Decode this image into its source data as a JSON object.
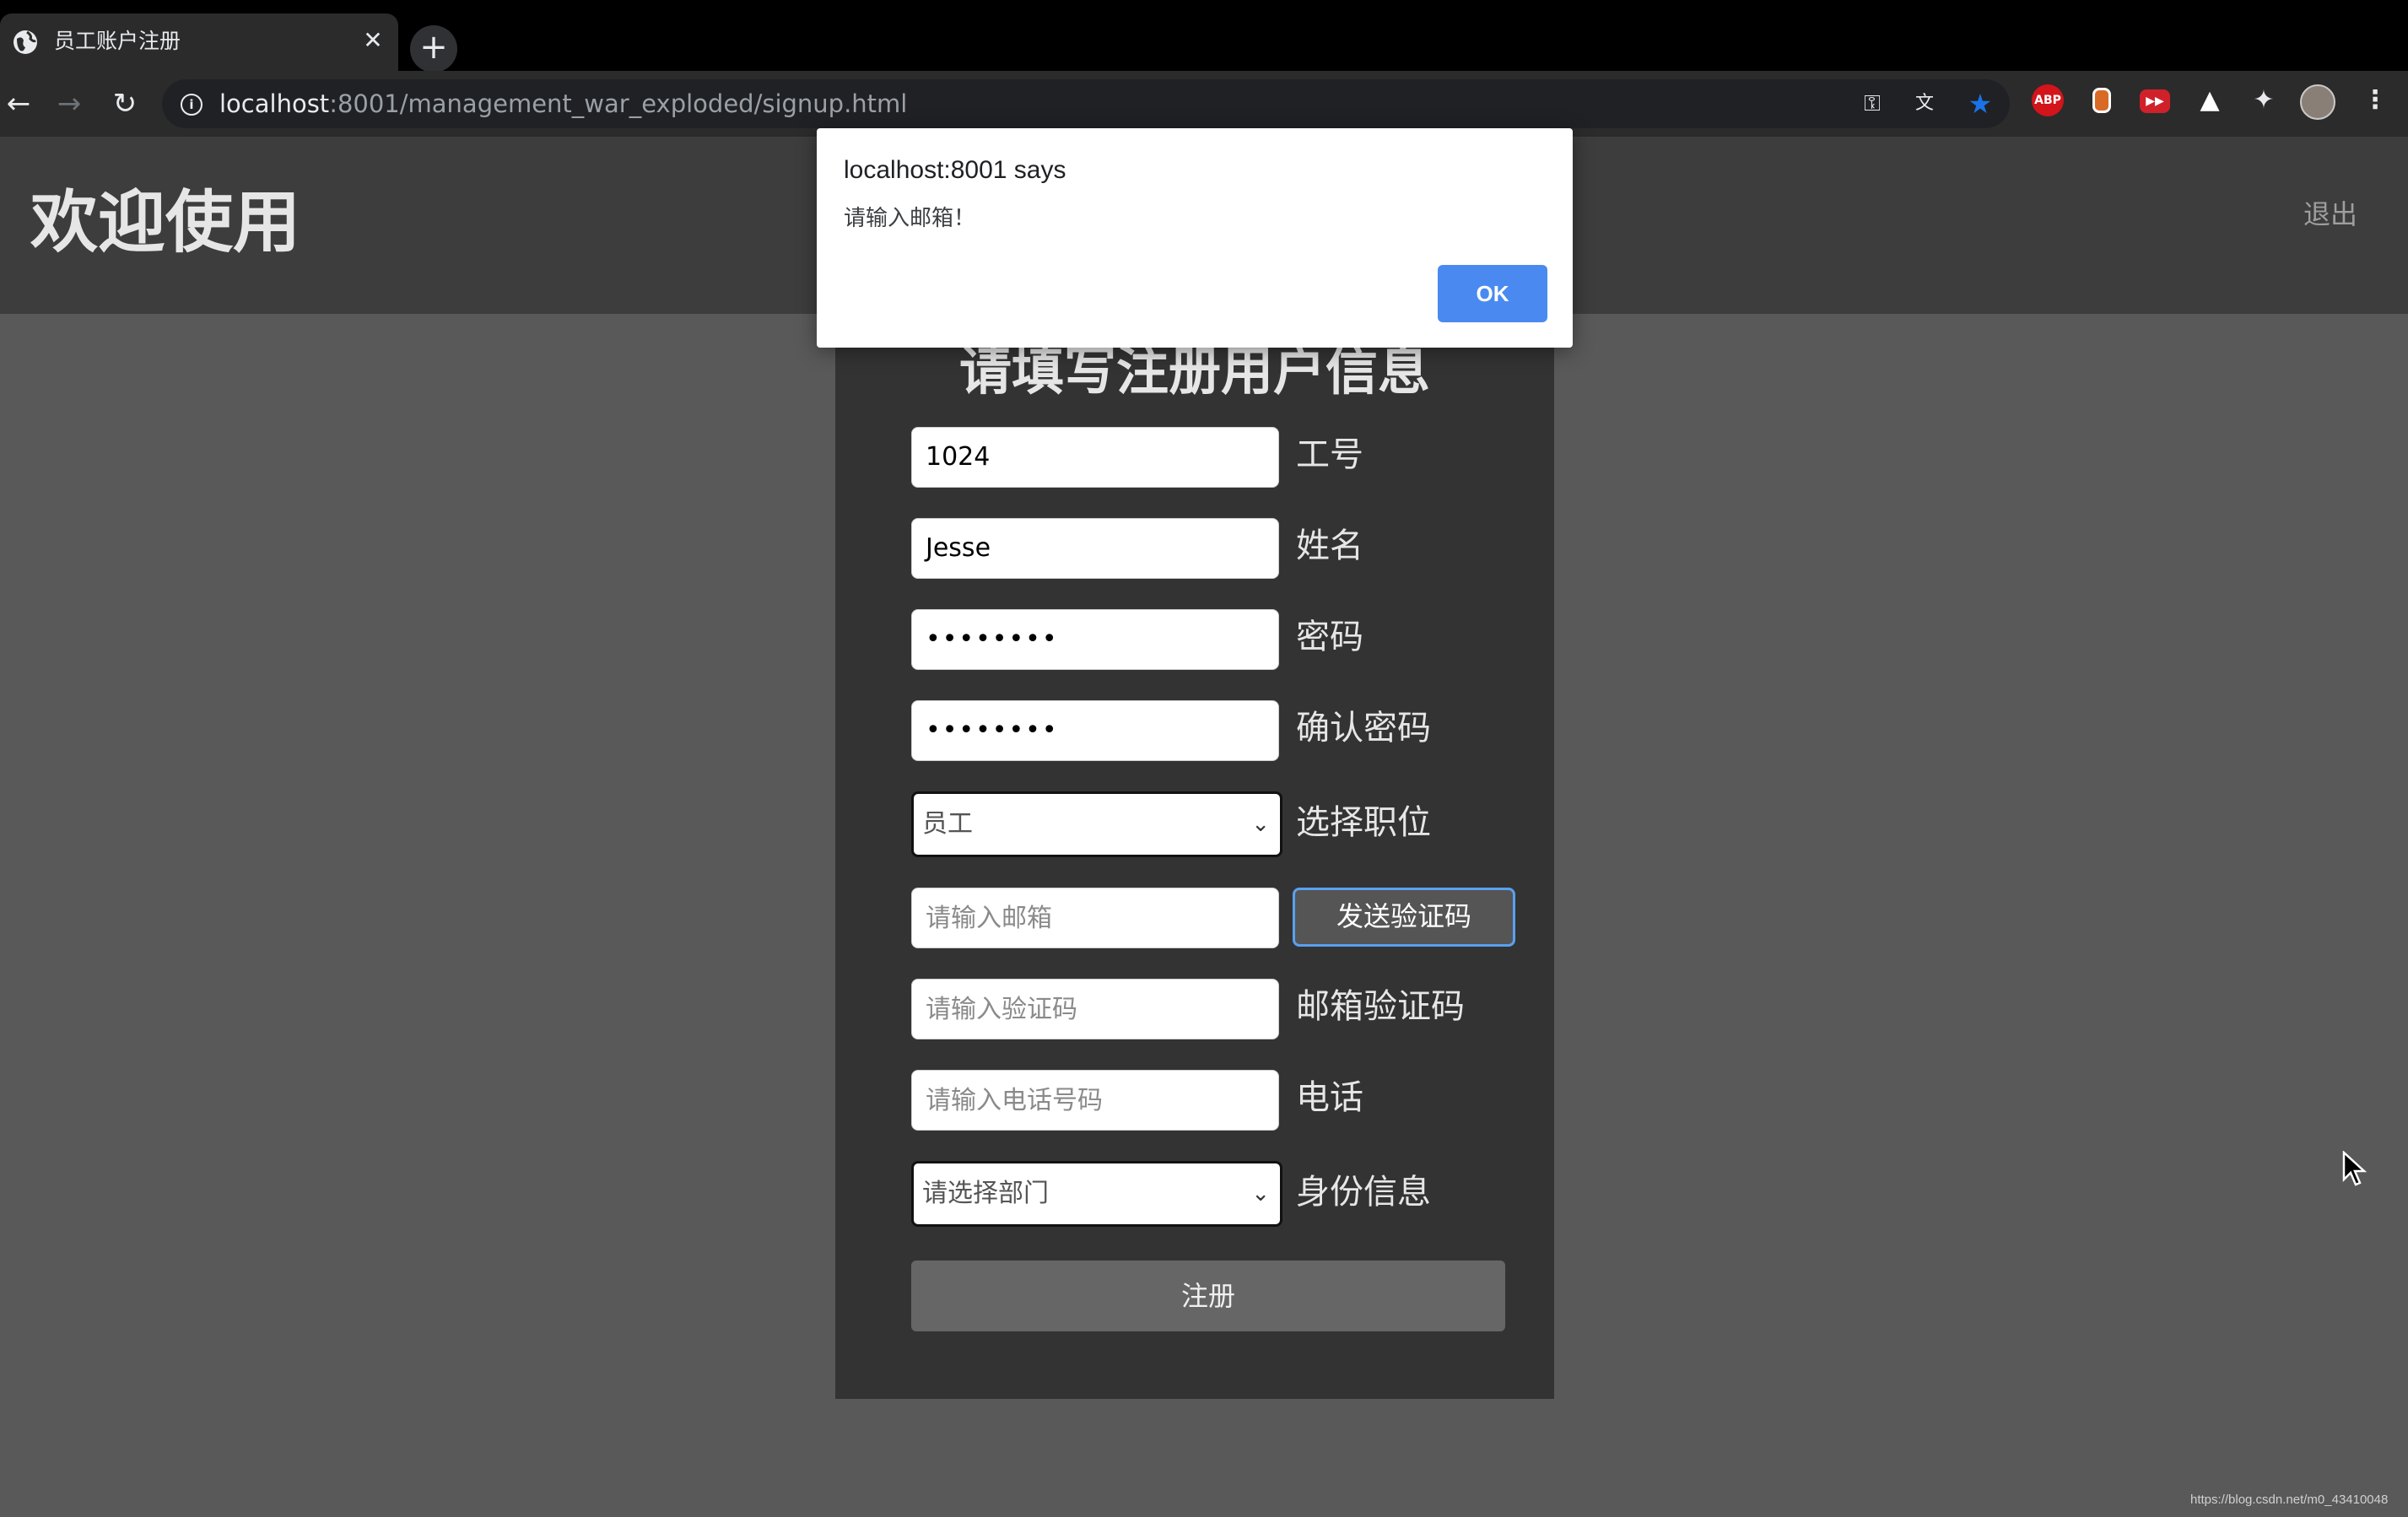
{
  "browser": {
    "tab_title": "员工账户注册",
    "new_tab_label": "+",
    "url_host": "localhost",
    "url_path": ":8001/management_war_exploded/signup.html",
    "extensions": [
      {
        "name": "adblock-plus-icon",
        "label": "ABP",
        "color": "#d3141a"
      },
      {
        "name": "recorder-extension-icon",
        "label": "",
        "color": "#d86a26"
      },
      {
        "name": "video-extension-icon",
        "label": "",
        "color": "#d0212b"
      },
      {
        "name": "mountain-extension-icon",
        "label": "",
        "color": "#ffffff"
      },
      {
        "name": "puzzle-extensions-icon",
        "label": "",
        "color": "#e8eaed"
      }
    ],
    "bookmark_star_color": "#1a73e8"
  },
  "header": {
    "title": "欢迎使用",
    "logout_label": "退出"
  },
  "form": {
    "title": "请填写注册用户信息",
    "employee_id": {
      "value": "1024",
      "label": "工号"
    },
    "name": {
      "value": "Jesse",
      "label": "姓名"
    },
    "password": {
      "value": "••••••••",
      "label": "密码"
    },
    "confirm_password": {
      "value": "••••••••",
      "label": "确认密码"
    },
    "position": {
      "selected": "员工",
      "label": "选择职位"
    },
    "email": {
      "placeholder": "请输入邮箱",
      "send_button": "发送验证码"
    },
    "verify_code": {
      "placeholder": "请输入验证码",
      "label": "邮箱验证码"
    },
    "phone": {
      "placeholder": "请输入电话号码",
      "label": "电话"
    },
    "department": {
      "selected": "请选择部门",
      "label": "身份信息"
    },
    "submit_label": "注册"
  },
  "dialog": {
    "title": "localhost:8001 says",
    "message": "请输入邮箱！",
    "ok_label": "OK"
  },
  "watermark": "https://blog.csdn.net/m0_43410048",
  "colors": {
    "page_bg": "#595959",
    "header_bg": "#3d3d3d",
    "card_bg": "#333333",
    "accent": "#4a8af0"
  }
}
